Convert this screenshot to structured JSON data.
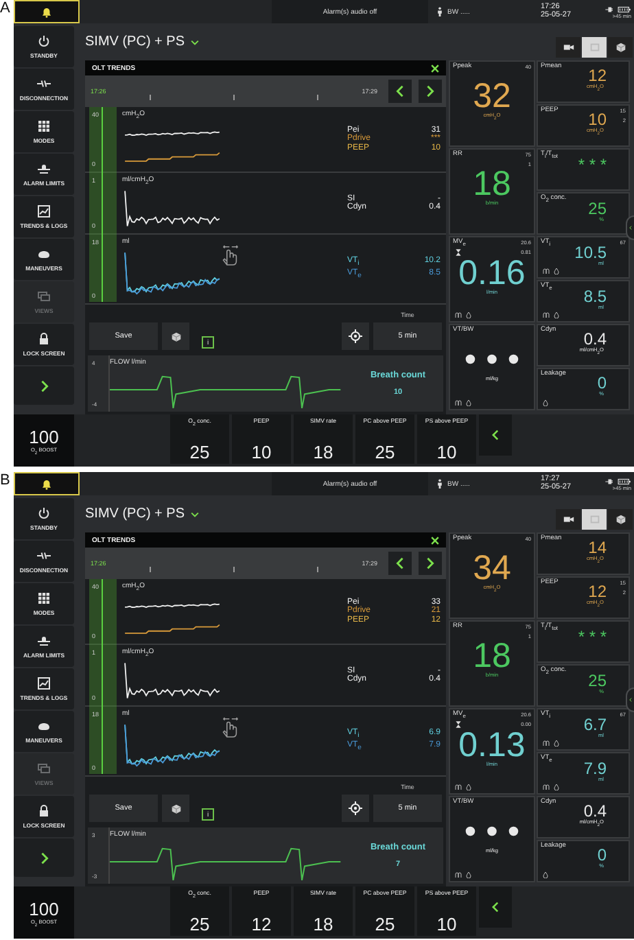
{
  "panels": [
    {
      "label": "A",
      "bell": true,
      "alarm_text": "Alarm(s) audio off",
      "patient": "BW .....",
      "time": "17:26",
      "date": "25-05-27",
      "battery": ">45 min",
      "mode": "SIMV (PC) + PS",
      "view_buttons": [
        {
          "selected": false
        },
        {
          "selected": true
        },
        {
          "selected": false
        }
      ],
      "sidebar": [
        {
          "label": "STANDBY",
          "disabled": false
        },
        {
          "label": "DISCONNECTION",
          "disabled": false
        },
        {
          "label": "MODES",
          "disabled": false
        },
        {
          "label": "ALARM LIMITS",
          "disabled": false
        },
        {
          "label": "TRENDS & LOGS",
          "disabled": false
        },
        {
          "label": "MANEUVERS",
          "disabled": false
        },
        {
          "label": "VIEWS",
          "disabled": true
        },
        {
          "label": "LOCK SCREEN",
          "disabled": false
        }
      ],
      "trends": {
        "title": "OLT TRENDS",
        "cursor_time": "17:26",
        "end_time": "17:29",
        "save": "Save",
        "info": "i",
        "time_label": "Time",
        "time_value": "5 min",
        "charts": [
          {
            "y_max": "40",
            "y_min": "0",
            "unit": "cmH$_{2}$O",
            "traces": [
              {
                "color": "#f0f0f0"
              },
              {
                "color": "#d89a3a"
              }
            ],
            "legend": [
              {
                "name": "Pei",
                "value": "31",
                "color": "#f0f0f0"
              },
              {
                "name": "Pdrive",
                "value": "***",
                "color": "#d89a3a"
              },
              {
                "name": "PEEP",
                "value": "10",
                "color": "#e8b848"
              }
            ]
          },
          {
            "y_max": "1",
            "y_min": "0",
            "unit": "ml/cmH$_{2}$O",
            "traces": [
              {
                "color": "#f0f0f0"
              }
            ],
            "legend": [
              {
                "name": "SI",
                "value": "-",
                "color": "#f0f0f0"
              },
              {
                "name": "Cdyn",
                "value": "0.4",
                "color": "#f0f0f0"
              }
            ]
          },
          {
            "y_max": "18",
            "y_min": "0",
            "unit": "ml",
            "traces": [
              {
                "color": "#60d0e0"
              },
              {
                "color": "#4a9ad8"
              }
            ],
            "legend": [
              {
                "name": "VT$_{i}$",
                "value": "10.2",
                "color": "#60d0e0"
              },
              {
                "name": "VT$_{e}$",
                "value": "8.5",
                "color": "#4a9ad8"
              }
            ]
          }
        ],
        "flow": {
          "title": "FLOW l/min",
          "y_max": "4",
          "y_min": "-4",
          "count_label": "Breath count",
          "count": "10"
        }
      },
      "monitor": [
        {
          "main": {
            "label": "Ppeak",
            "limit_high": "40",
            "value": "32",
            "unit": "cmH$_{2}$O",
            "color": "#e0a850"
          },
          "side": [
            {
              "label": "Pmean",
              "value": "12",
              "unit": "cmH$_{2}$O",
              "color": "#e0a850"
            },
            {
              "label": "PEEP",
              "limit_high": "15",
              "limit_low": "2",
              "value": "10",
              "unit": "cmH$_{2}$O",
              "color": "#e0a850"
            }
          ]
        },
        {
          "main": {
            "label": "RR",
            "limit_high": "75",
            "limit_low": "1",
            "value": "18",
            "unit": "b/min",
            "color": "#4cc860"
          },
          "side": [
            {
              "label": "T$_{i}$/T$_{tot}$",
              "value": "* * *",
              "color": "#4cc860"
            },
            {
              "label": "O$_{2}$ conc.",
              "value": "25",
              "unit": "%",
              "color": "#4cc860"
            }
          ]
        },
        {
          "main": {
            "label": "MV$_{e}$",
            "limit_high": "20.6",
            "limit_low": "0.81",
            "value": "0.16",
            "unit": "l/min",
            "color": "#70d0d0",
            "alarm_icon": true,
            "status_icons": true
          },
          "side": [
            {
              "label": "VT$_{i}$",
              "limit_high": "67",
              "value": "10.5",
              "unit": "ml",
              "color": "#70d0d0",
              "status_icons": true
            },
            {
              "label": "VT$_{e}$",
              "value": "8.5",
              "unit": "ml",
              "color": "#70d0d0",
              "status_icons": true
            }
          ]
        },
        {
          "main": {
            "label": "VT/BW",
            "value": "• • •",
            "unit": "ml/kg",
            "color": "#e8e8e8",
            "status_icons": true
          },
          "side": [
            {
              "label": "Cdyn",
              "value": "0.4",
              "unit": "ml/cmH$_{2}$O",
              "color": "#e8e8e8"
            },
            {
              "label": "Leakage",
              "value": "0",
              "unit": "%",
              "color": "#70d0d0",
              "leak_icon": true
            }
          ]
        }
      ],
      "boost": {
        "value": "100",
        "label": "O$_{2}$ BOOST"
      },
      "settings": [
        {
          "label": "O$_{2}$ conc.",
          "value": "25"
        },
        {
          "label": "PEEP",
          "value": "10"
        },
        {
          "label": "SIMV rate",
          "value": "18"
        },
        {
          "label": "PC above PEEP",
          "value": "25"
        },
        {
          "label": "PS above PEEP",
          "value": "10"
        }
      ]
    },
    {
      "label": "B",
      "bell": true,
      "alarm_text": "Alarm(s) audio off",
      "patient": "BW .....",
      "time": "17:27",
      "date": "25-05-27",
      "battery": ">45 min",
      "mode": "SIMV (PC) + PS",
      "view_buttons": [
        {
          "selected": false
        },
        {
          "selected": true
        },
        {
          "selected": false
        }
      ],
      "sidebar": [
        {
          "label": "STANDBY",
          "disabled": false
        },
        {
          "label": "DISCONNECTION",
          "disabled": false
        },
        {
          "label": "MODES",
          "disabled": false
        },
        {
          "label": "ALARM LIMITS",
          "disabled": false
        },
        {
          "label": "TRENDS & LOGS",
          "disabled": false
        },
        {
          "label": "MANEUVERS",
          "disabled": false
        },
        {
          "label": "VIEWS",
          "disabled": true
        },
        {
          "label": "LOCK SCREEN",
          "disabled": false
        }
      ],
      "trends": {
        "title": "OLT TRENDS",
        "cursor_time": "17:26",
        "end_time": "17:29",
        "save": "Save",
        "info": "i",
        "time_label": "Time",
        "time_value": "5 min",
        "charts": [
          {
            "y_max": "40",
            "y_min": "0",
            "unit": "cmH$_{2}$O",
            "traces": [
              {
                "color": "#f0f0f0"
              },
              {
                "color": "#d89a3a"
              }
            ],
            "legend": [
              {
                "name": "Pei",
                "value": "33",
                "color": "#f0f0f0"
              },
              {
                "name": "Pdrive",
                "value": "21",
                "color": "#d89a3a"
              },
              {
                "name": "PEEP",
                "value": "12",
                "color": "#e8b848"
              }
            ]
          },
          {
            "y_max": "1",
            "y_min": "0",
            "unit": "ml/cmH$_{2}$O",
            "traces": [
              {
                "color": "#f0f0f0"
              }
            ],
            "legend": [
              {
                "name": "SI",
                "value": "-",
                "color": "#f0f0f0"
              },
              {
                "name": "Cdyn",
                "value": "0.4",
                "color": "#f0f0f0"
              }
            ]
          },
          {
            "y_max": "18",
            "y_min": "0",
            "unit": "ml",
            "traces": [
              {
                "color": "#60d0e0"
              },
              {
                "color": "#4a9ad8"
              }
            ],
            "legend": [
              {
                "name": "VT$_{i}$",
                "value": "6.9",
                "color": "#60d0e0"
              },
              {
                "name": "VT$_{e}$",
                "value": "7.9",
                "color": "#4a9ad8"
              }
            ]
          }
        ],
        "flow": {
          "title": "FLOW l/min",
          "y_max": "3",
          "y_min": "-3",
          "count_label": "Breath count",
          "count": "7"
        }
      },
      "monitor": [
        {
          "main": {
            "label": "Ppeak",
            "limit_high": "40",
            "value": "34",
            "unit": "cmH$_{2}$O",
            "color": "#e0a850"
          },
          "side": [
            {
              "label": "Pmean",
              "value": "14",
              "unit": "cmH$_{2}$O",
              "color": "#e0a850"
            },
            {
              "label": "PEEP",
              "limit_high": "15",
              "limit_low": "2",
              "value": "12",
              "unit": "cmH$_{2}$O",
              "color": "#e0a850"
            }
          ]
        },
        {
          "main": {
            "label": "RR",
            "limit_high": "75",
            "limit_low": "1",
            "value": "18",
            "unit": "b/min",
            "color": "#4cc860"
          },
          "side": [
            {
              "label": "T$_{i}$/T$_{tot}$",
              "value": "* * *",
              "color": "#4cc860"
            },
            {
              "label": "O$_{2}$ conc.",
              "value": "25",
              "unit": "%",
              "color": "#4cc860"
            }
          ]
        },
        {
          "main": {
            "label": "MV$_{e}$",
            "limit_high": "20.6",
            "limit_low": "0.00",
            "value": "0.13",
            "unit": "l/min",
            "color": "#70d0d0",
            "alarm_icon": true,
            "status_icons": true
          },
          "side": [
            {
              "label": "VT$_{i}$",
              "limit_high": "67",
              "value": "6.7",
              "unit": "ml",
              "color": "#70d0d0",
              "status_icons": true
            },
            {
              "label": "VT$_{e}$",
              "value": "7.9",
              "unit": "ml",
              "color": "#70d0d0",
              "status_icons": true
            }
          ]
        },
        {
          "main": {
            "label": "VT/BW",
            "value": "• • •",
            "unit": "ml/kg",
            "color": "#e8e8e8",
            "status_icons": true
          },
          "side": [
            {
              "label": "Cdyn",
              "value": "0.4",
              "unit": "ml/cmH$_{2}$O",
              "color": "#e8e8e8"
            },
            {
              "label": "Leakage",
              "value": "0",
              "unit": "%",
              "color": "#70d0d0",
              "leak_icon": true
            }
          ]
        }
      ],
      "boost": {
        "value": "100",
        "label": "O$_{2}$ BOOST"
      },
      "settings": [
        {
          "label": "O$_{2}$ conc.",
          "value": "25"
        },
        {
          "label": "PEEP",
          "value": "12"
        },
        {
          "label": "SIMV rate",
          "value": "18"
        },
        {
          "label": "PC above PEEP",
          "value": "25"
        },
        {
          "label": "PS above PEEP",
          "value": "10"
        }
      ]
    }
  ]
}
